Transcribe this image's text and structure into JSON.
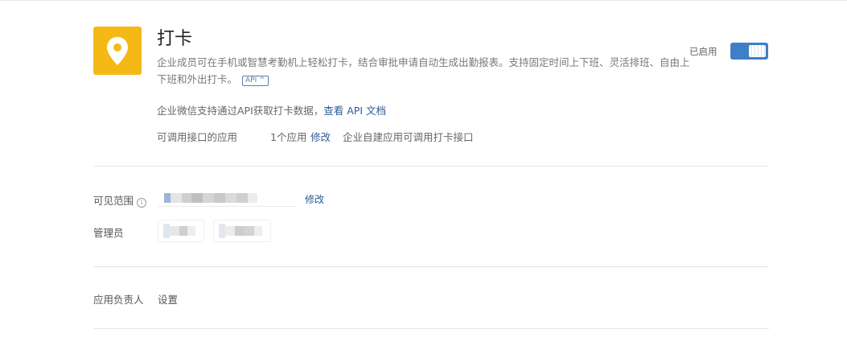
{
  "app": {
    "title": "打卡",
    "icon": "location-pin-icon",
    "icon_bg": "#f5b916",
    "description": "企业成员可在手机或智慧考勤机上轻松打卡，结合审批申请自动生成出勤报表。支持固定时间上下班、灵活排班、自由上下班和外出打卡。",
    "api_tag": "API ^"
  },
  "status": {
    "label": "已启用",
    "enabled": true,
    "toggle_color": "#3e7fc6"
  },
  "api_info": {
    "text": "企业微信支持通过API获取打卡数据，",
    "link": "查看 API 文档"
  },
  "callable": {
    "label": "可调用接口的应用",
    "count": "1个应用",
    "modify": "修改",
    "note": "企业自建应用可调用打卡接口"
  },
  "visibility": {
    "label": "可见范围",
    "info_icon": "i",
    "modify": "修改"
  },
  "admins": {
    "label": "管理员"
  },
  "owner": {
    "label": "应用负责人",
    "action": "设置"
  },
  "colors": {
    "link": "#2b5b96",
    "divider": "#e4e6e9"
  }
}
